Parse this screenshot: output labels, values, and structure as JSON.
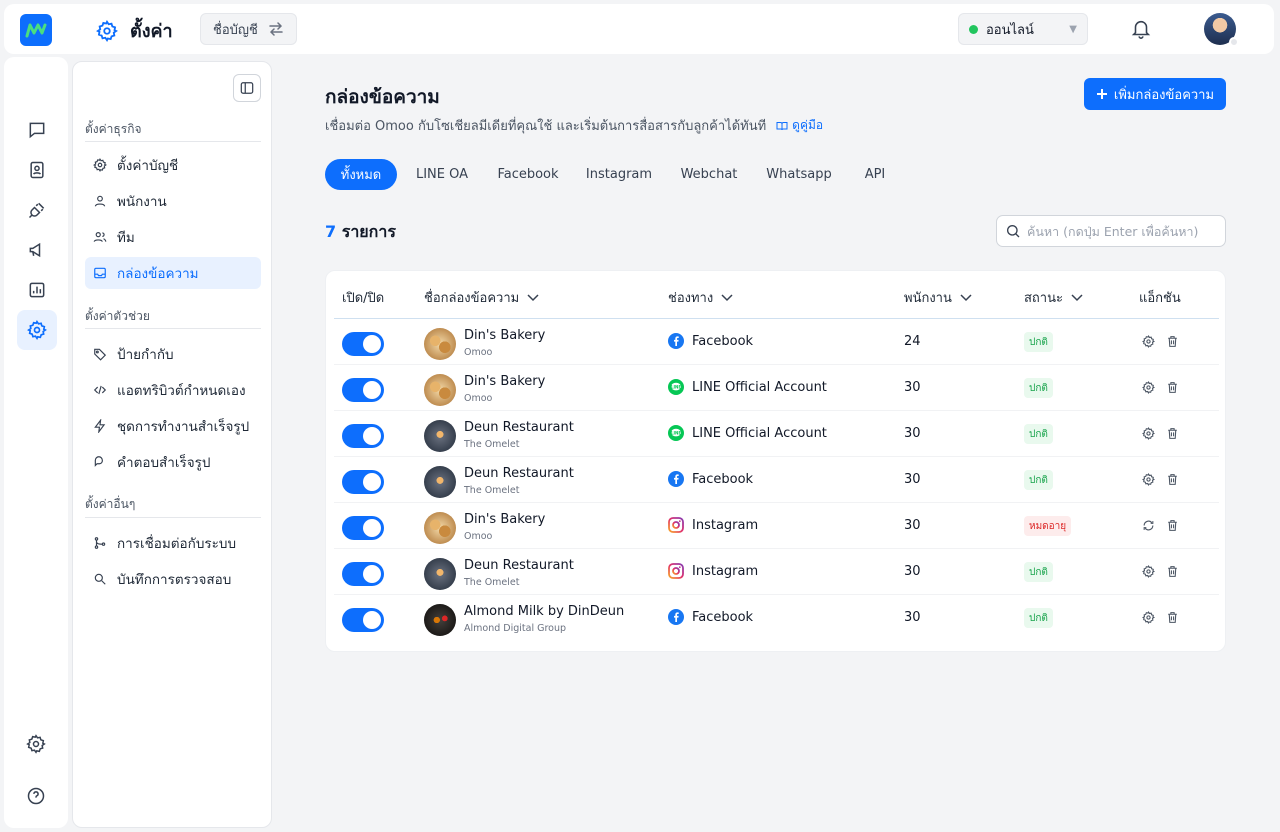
{
  "header": {
    "title": "ตั้งค่า",
    "account_label": "ชื่อบัญชี",
    "status_label": "ออนไลน์"
  },
  "sidebar": {
    "groups": [
      {
        "title": "ตั้งค่าธุรกิจ",
        "items": [
          {
            "label": "ตั้งค่าบัญชี",
            "icon": "gear-icon"
          },
          {
            "label": "พนักงาน",
            "icon": "user-icon"
          },
          {
            "label": "ทีม",
            "icon": "users-icon"
          },
          {
            "label": "กล่องข้อความ",
            "icon": "inbox-icon",
            "active": true
          }
        ]
      },
      {
        "title": "ตั้งค่าตัวช่วย",
        "items": [
          {
            "label": "ป้ายกำกับ",
            "icon": "tag-icon"
          },
          {
            "label": "แอตทริบิวต์กำหนดเอง",
            "icon": "code-icon"
          },
          {
            "label": "ชุดการทำงานสำเร็จรูป",
            "icon": "lightning-icon"
          },
          {
            "label": "คำตอบสำเร็จรูป",
            "icon": "chat-bubble-icon"
          }
        ]
      },
      {
        "title": "ตั้งค่าอื่นๆ",
        "items": [
          {
            "label": "การเชื่อมต่อกับระบบ",
            "icon": "branch-icon"
          },
          {
            "label": "บันทึกการตรวจสอบ",
            "icon": "search-doc-icon"
          }
        ]
      }
    ]
  },
  "main": {
    "title": "กล่องข้อความ",
    "subtitle": "เชื่อมต่อ Omoo กับโซเชียลมีเดียที่คุณใช้ และเริ่มต้นการสื่อสารกับลูกค้าได้ทันที",
    "guide_link": "ดูคู่มือ",
    "add_button": "เพิ่มกล่องข้อความ",
    "tabs": [
      "ทั้งหมด",
      "LINE OA",
      "Facebook",
      "Instagram",
      "Webchat",
      "Whatsapp",
      "API"
    ],
    "count_number": "7",
    "count_label": "รายการ",
    "search_placeholder": "ค้นหา (กดปุ่ม Enter เพื่อค้นหา)"
  },
  "table": {
    "columns": [
      "เปิด/ปิด",
      "ชื่อกล่องข้อความ",
      "ช่องทาง",
      "พนักงาน",
      "สถานะ",
      "แอ็กชัน"
    ],
    "rows": [
      {
        "enabled": true,
        "name": "Din's Bakery",
        "org": "Omoo",
        "avatar": "bakery",
        "channel": "Facebook",
        "channel_icon": "facebook-icon",
        "staff": "24",
        "status": "ปกติ",
        "status_type": "ok",
        "action_icon": "gear-icon"
      },
      {
        "enabled": true,
        "name": "Din's Bakery",
        "org": "Omoo",
        "avatar": "bakery",
        "channel": "LINE Official Account",
        "channel_icon": "line-icon",
        "staff": "30",
        "status": "ปกติ",
        "status_type": "ok",
        "action_icon": "gear-icon"
      },
      {
        "enabled": true,
        "name": "Deun Restaurant",
        "org": "The Omelet",
        "avatar": "restaurant",
        "channel": "LINE Official Account",
        "channel_icon": "line-icon",
        "staff": "30",
        "status": "ปกติ",
        "status_type": "ok",
        "action_icon": "gear-icon"
      },
      {
        "enabled": true,
        "name": "Deun Restaurant",
        "org": "The Omelet",
        "avatar": "restaurant",
        "channel": "Facebook",
        "channel_icon": "facebook-icon",
        "staff": "30",
        "status": "ปกติ",
        "status_type": "ok",
        "action_icon": "gear-icon"
      },
      {
        "enabled": true,
        "name": "Din's Bakery",
        "org": "Omoo",
        "avatar": "bakery",
        "channel": "Instagram",
        "channel_icon": "instagram-icon",
        "staff": "30",
        "status": "หมดอายุ",
        "status_type": "exp",
        "action_icon": "refresh-icon"
      },
      {
        "enabled": true,
        "name": "Deun Restaurant",
        "org": "The Omelet",
        "avatar": "restaurant",
        "channel": "Instagram",
        "channel_icon": "instagram-icon",
        "staff": "30",
        "status": "ปกติ",
        "status_type": "ok",
        "action_icon": "gear-icon"
      },
      {
        "enabled": true,
        "name": "Almond Milk by DinDeun",
        "org": "Almond Digital Group",
        "avatar": "almond",
        "channel": "Facebook",
        "channel_icon": "facebook-icon",
        "staff": "30",
        "status": "ปกติ",
        "status_type": "ok",
        "action_icon": "gear-icon"
      }
    ]
  },
  "colors": {
    "primary": "#0d6efd",
    "online": "#22c55e",
    "status_ok_text": "#16a34a",
    "status_expired_text": "#dc2626"
  }
}
